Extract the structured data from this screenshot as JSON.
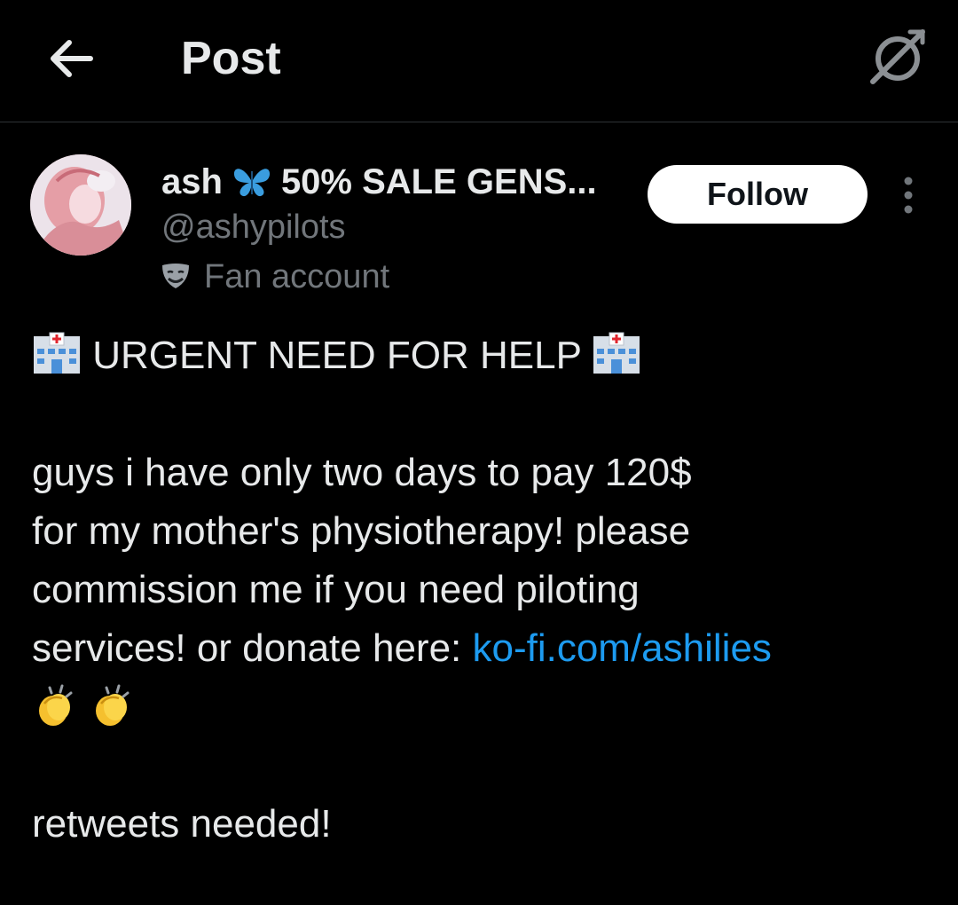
{
  "header": {
    "title": "Post",
    "back_icon": "arrow-left-icon",
    "grok_icon": "grok-icon"
  },
  "author": {
    "name": "ash",
    "name_emoji": "butterfly-icon",
    "name_suffix": "50% SALE GENS...",
    "handle": "@ashypilots",
    "label_icon": "performing-arts-mask-icon",
    "label": "Fan account",
    "follow_label": "Follow",
    "more_icon": "more-vertical-icon"
  },
  "post": {
    "headline": "URGENT NEED FOR HELP",
    "headline_icon": "hospital-icon",
    "line1": "guys i have only two days to pay 120$",
    "line2": "for my mother's physiotherapy! please",
    "line3": "commission me if you need piloting",
    "line4_text": "services! or donate here: ",
    "link": "ko-fi.com/ashilies",
    "clap_icon": "clapping-hands-icon",
    "closing": "retweets needed!"
  },
  "colors": {
    "background": "#000000",
    "text": "#e7e9ea",
    "secondary_text": "#71767b",
    "link": "#1d9bf0",
    "follow_bg": "#ffffff",
    "divider": "#2f3336"
  }
}
